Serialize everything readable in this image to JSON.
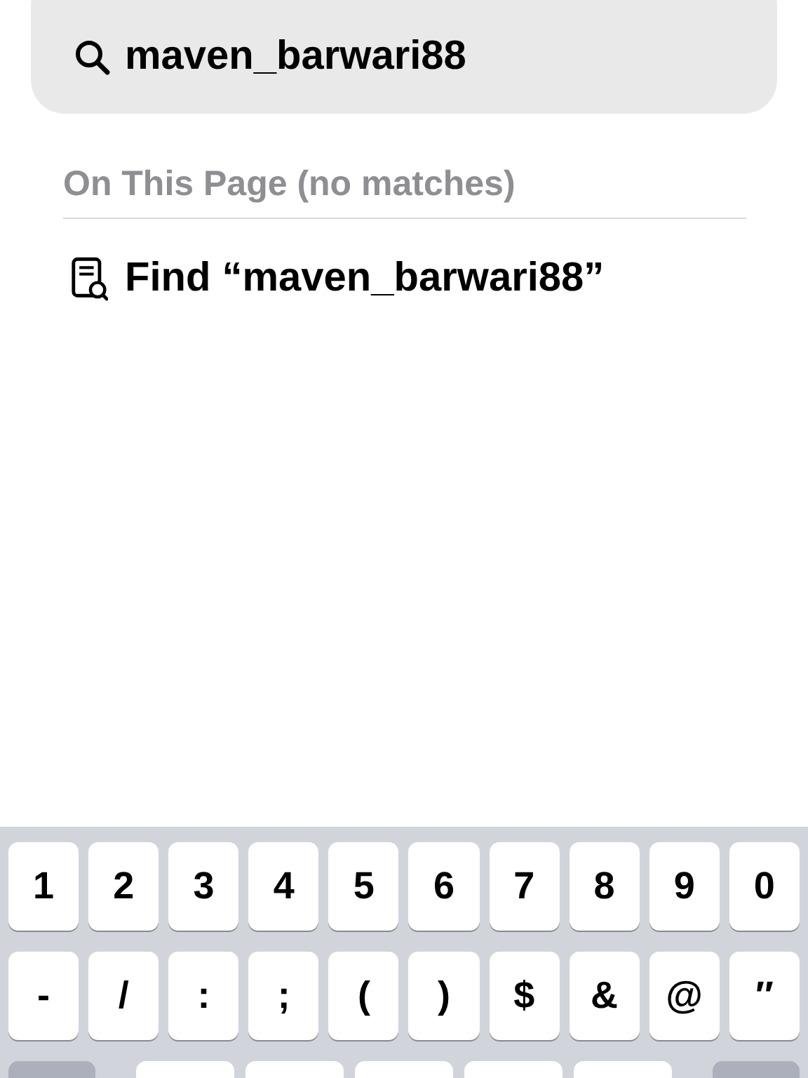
{
  "search": {
    "value": "maven_barwari88"
  },
  "section": {
    "title": "On This Page (no matches)"
  },
  "find_row": {
    "label": "Find “maven_barwari88”"
  },
  "keyboard": {
    "rows": [
      [
        "1",
        "2",
        "3",
        "4",
        "5",
        "6",
        "7",
        "8",
        "9",
        "0"
      ],
      [
        "-",
        "/",
        ":",
        ";",
        "(",
        ")",
        "$",
        "&",
        "@",
        "″"
      ]
    ],
    "partial_row": [
      {
        "kind": "special"
      },
      {
        "kind": "plain"
      },
      {
        "kind": "plain"
      },
      {
        "kind": "plain"
      },
      {
        "kind": "plain"
      },
      {
        "kind": "plain"
      },
      {
        "kind": "special"
      }
    ]
  }
}
